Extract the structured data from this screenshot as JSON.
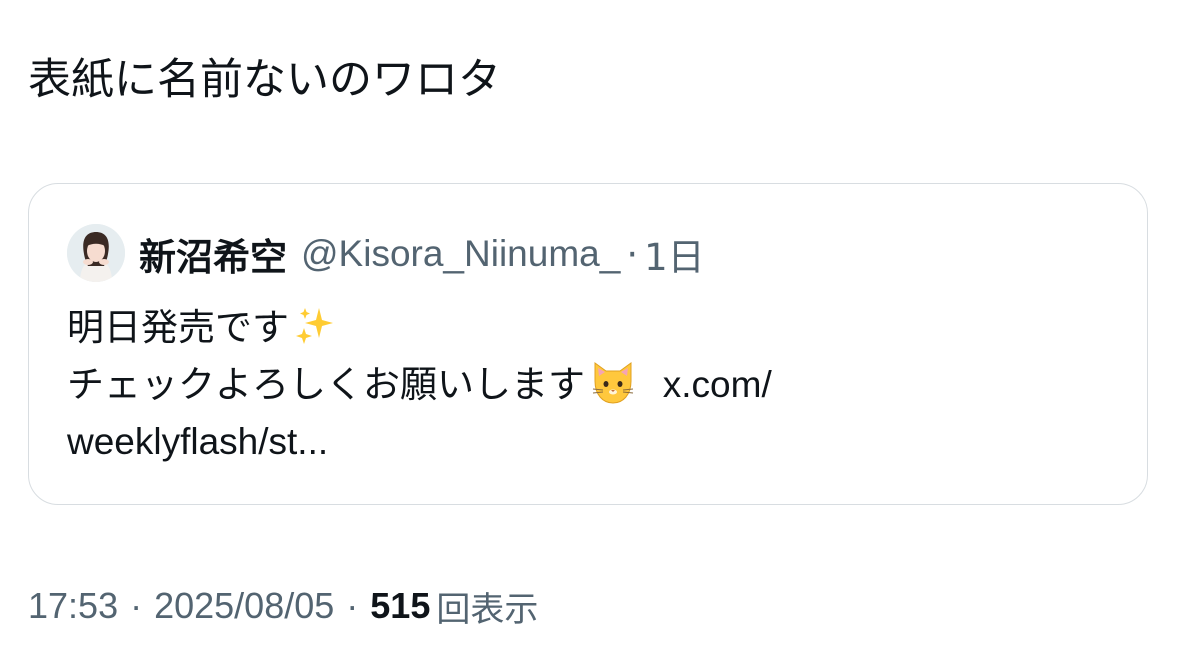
{
  "post": {
    "text": "表紙に名前ないのワロタ"
  },
  "quote": {
    "display_name": "新沼希空",
    "handle": "@Kisora_Niinuma_",
    "separator": "·",
    "time_ago": "1日",
    "line1": "明日発売です",
    "line1_emoji": "sparkles-emoji",
    "line2": "チェックよろしくお願いします",
    "line2_emoji": "cat-face-emoji",
    "link_part1": "x.com/",
    "link_part2": "weeklyflash/st..."
  },
  "meta": {
    "time": "17:53",
    "sep1": "·",
    "date": "2025/08/05",
    "sep2": "·",
    "views_count": "515",
    "views_label": "回表示"
  },
  "colors": {
    "text_primary": "#0f1419",
    "text_secondary": "#536471",
    "border": "#d8dde1"
  }
}
